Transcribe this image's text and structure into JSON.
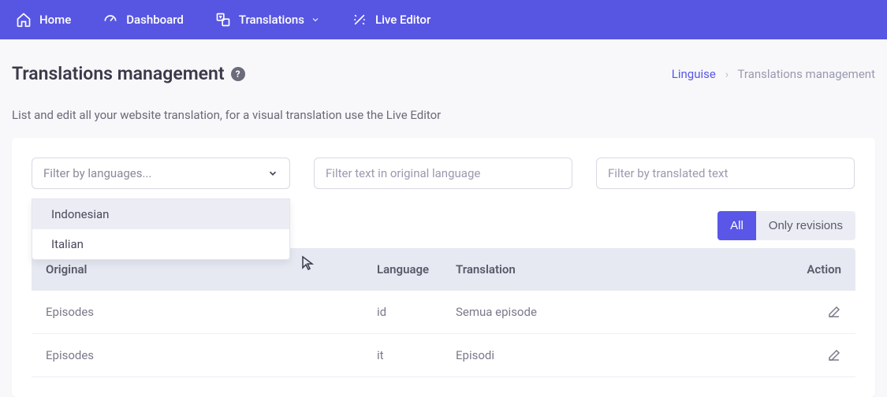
{
  "nav": {
    "home": "Home",
    "dashboard": "Dashboard",
    "translations": "Translations",
    "live_editor": "Live Editor"
  },
  "header": {
    "title": "Translations management",
    "help_char": "?"
  },
  "breadcrumb": {
    "root": "Linguise",
    "sep": "›",
    "current": "Translations management"
  },
  "subtitle": "List and edit all your website translation, for a visual translation use the Live Editor",
  "filters": {
    "lang_placeholder": "Filter by languages...",
    "original_placeholder": "Filter text in original language",
    "translated_placeholder": "Filter by translated text",
    "dropdown": [
      "Indonesian",
      "Italian"
    ]
  },
  "toggle": {
    "all": "All",
    "revisions": "Only revisions"
  },
  "table": {
    "headers": {
      "original": "Original",
      "language": "Language",
      "translation": "Translation",
      "action": "Action"
    },
    "rows": [
      {
        "original": "Episodes",
        "language": "id",
        "translation": "Semua episode"
      },
      {
        "original": "Episodes",
        "language": "it",
        "translation": "Episodi"
      }
    ]
  }
}
